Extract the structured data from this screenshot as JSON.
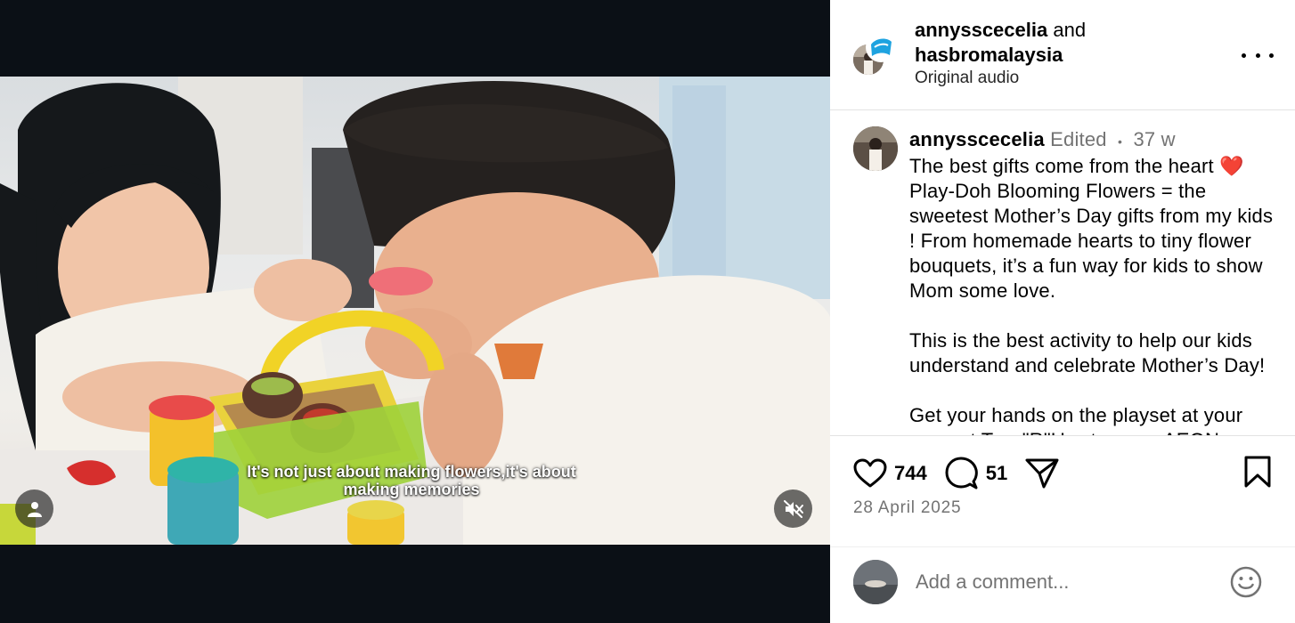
{
  "video": {
    "subtitle": "It's not just about making flowers,it's about making memories"
  },
  "header": {
    "user1": "annysscecelia",
    "joiner": "and",
    "user2": "hasbromalaysia",
    "audio": "Original audio"
  },
  "caption": {
    "username": "annysscecelia",
    "edited": "Edited",
    "separator": "•",
    "age": "37 w",
    "text": "The best gifts come from the heart ❤️\nPlay-Doh Blooming Flowers = the sweetest Mother’s Day gifts from my kids ! From homemade hearts to tiny flower bouquets, it’s a fun way for kids to show Mom some love.\n\nThis is the best activity to help our kids understand and celebrate Mother’s Day!\n\nGet your hands on the playset at your nearest Toys\"R\"Us stores or AEON"
  },
  "actions": {
    "likes": "744",
    "comments": "51",
    "date": "28 April 2025"
  },
  "comment_box": {
    "placeholder": "Add a comment..."
  },
  "icons": {
    "like": "heart-icon",
    "comment": "comment-bubble-icon",
    "share": "paper-plane-icon",
    "save": "bookmark-icon",
    "emoji": "smiley-icon",
    "more": "more-dots-icon",
    "mute": "muted-speaker-icon",
    "tags": "person-icon"
  }
}
